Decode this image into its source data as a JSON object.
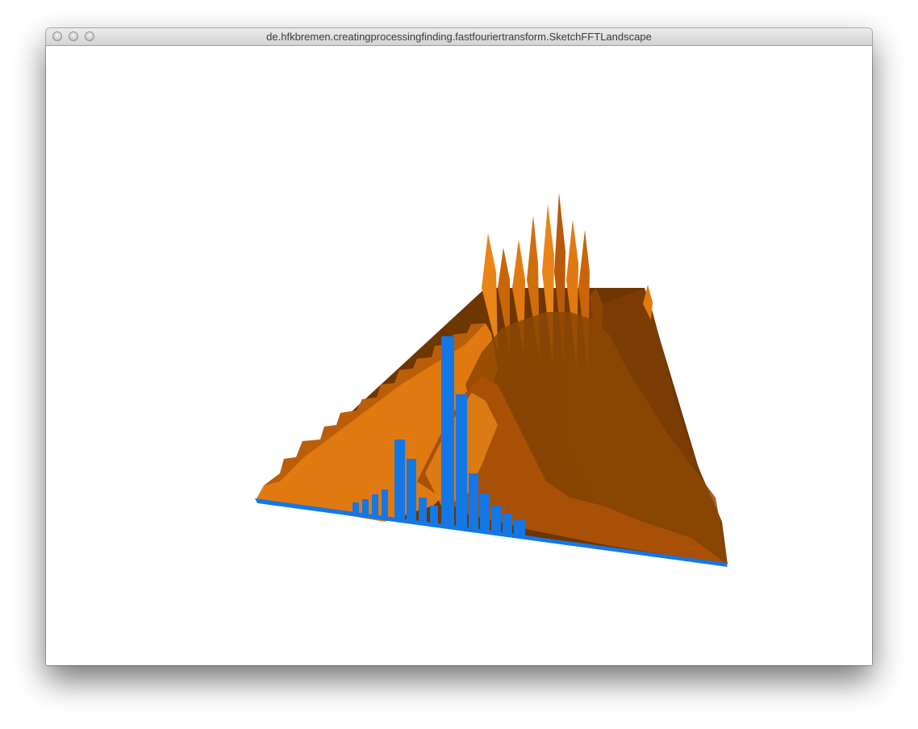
{
  "window": {
    "title": "de.hfkbremen.creatingprocessingfinding.fastfouriertransform.SketchFFTLandscape",
    "controls": [
      "close-button",
      "minimize-button",
      "zoom-button"
    ]
  },
  "sketch": {
    "surface_light": "#e07a10",
    "surface_mid": "#b85a08",
    "surface_dark": "#6e3600",
    "spectrum_color": "#1477e6",
    "background": "#ffffff"
  }
}
